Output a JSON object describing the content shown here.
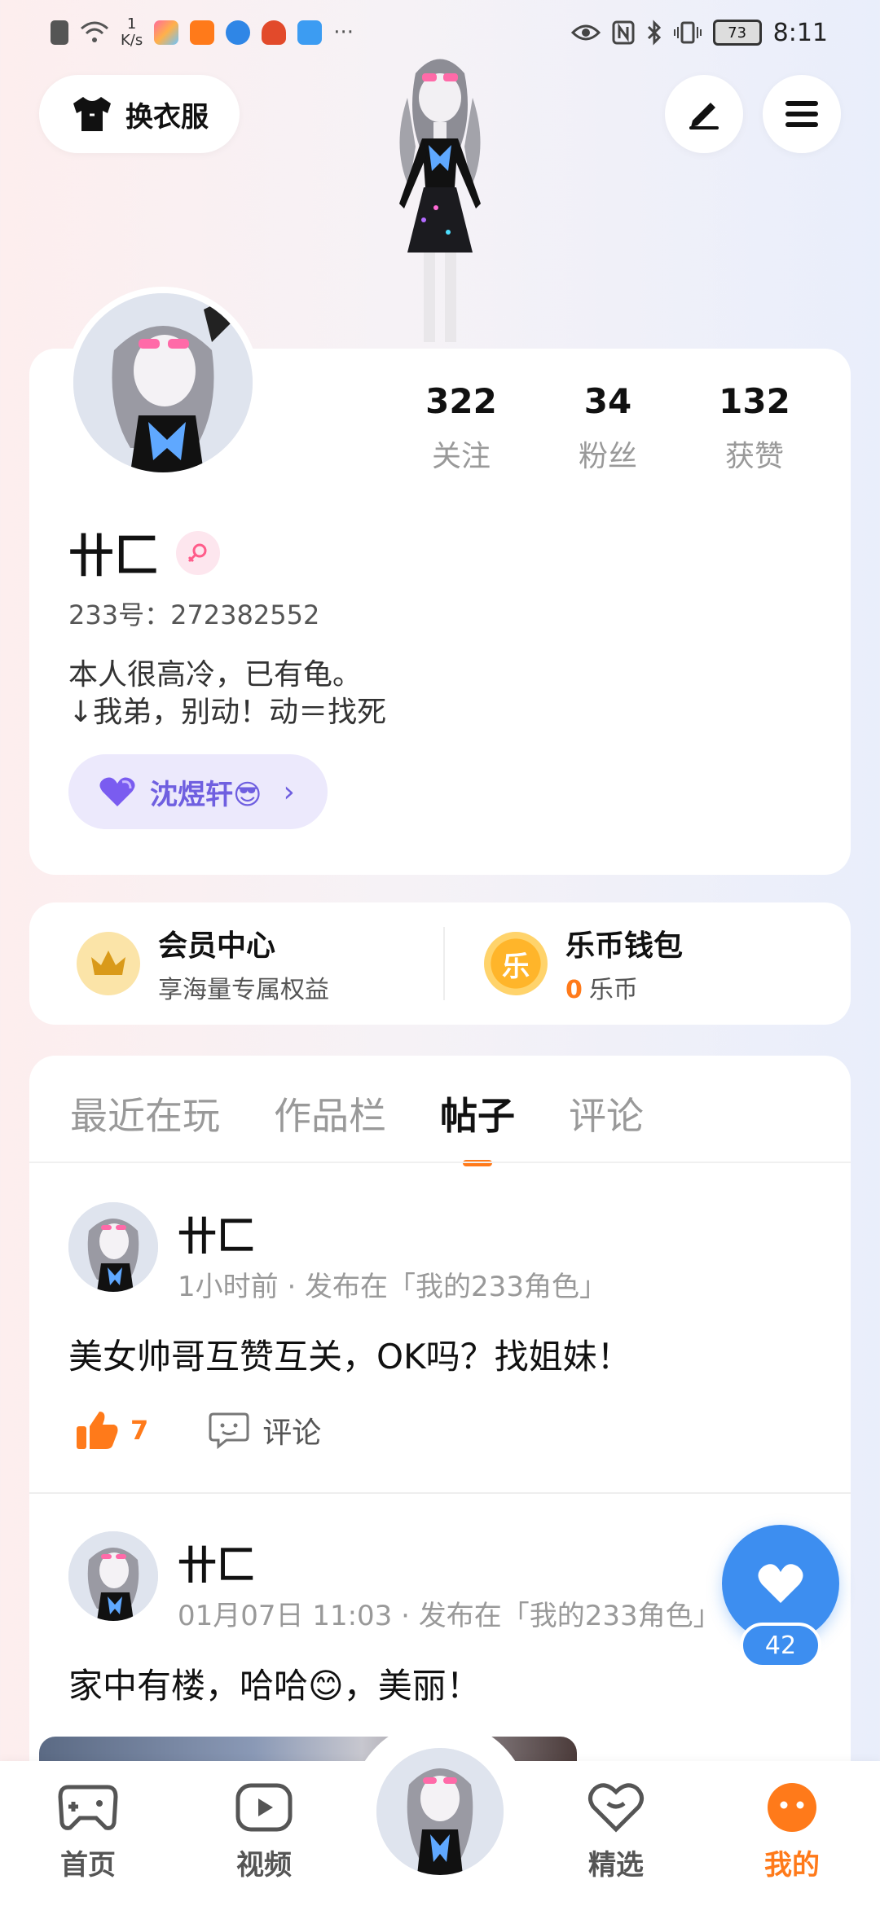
{
  "status_bar": {
    "speed_value": "1",
    "speed_unit": "K/s",
    "battery": "73",
    "time": "8:11",
    "more": "···"
  },
  "top": {
    "outfit_label": "换衣服"
  },
  "profile": {
    "stats": [
      {
        "num": "322",
        "label": "关注"
      },
      {
        "num": "34",
        "label": "粉丝"
      },
      {
        "num": "132",
        "label": "获赞"
      }
    ],
    "nickname": "卄匚",
    "uid": "233号：272382552",
    "bio_line1": "本人很高冷，已有龟。",
    "bio_line2": "↓我弟，别动！动＝找死",
    "relation_name": "沈煜轩😎",
    "relation_chevron": "›"
  },
  "member": {
    "title": "会员中心",
    "sub": "享海量专属权益"
  },
  "wallet": {
    "icon_char": "乐",
    "title": "乐币钱包",
    "count": "0",
    "unit": "乐币"
  },
  "tabs": [
    "最近在玩",
    "作品栏",
    "帖子",
    "评论"
  ],
  "posts": [
    {
      "name": "卄匚",
      "meta": "1小时前 · 发布在「我的233角色」",
      "text": "美女帅哥互赞互关，OK吗？找姐妹！",
      "likes": "7",
      "comment_label": "评论"
    },
    {
      "name": "卄匚",
      "meta": "01月07日 11:03 · 发布在「我的233角色」",
      "text": "家中有楼，哈哈😊，美丽！"
    }
  ],
  "float_like_count": "42",
  "nav": {
    "home": "首页",
    "video": "视频",
    "featured": "精选",
    "mine": "我的"
  },
  "colors": {
    "accent": "#ff7a1a",
    "like_blue": "#3d8ef0",
    "relation_purple": "#6f5fe0"
  }
}
